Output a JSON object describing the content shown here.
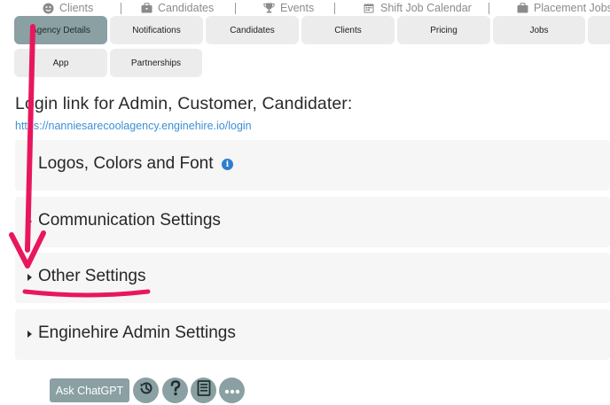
{
  "top_nav": {
    "items": [
      {
        "label": "Clients",
        "icon": "smiley-icon"
      },
      {
        "label": "Candidates",
        "icon": "briefcase-icon"
      },
      {
        "label": "Events",
        "icon": "trophy-icon"
      },
      {
        "label": "Shift Job Calendar",
        "icon": "calendar-icon"
      },
      {
        "label": "Placement Jobs",
        "icon": "briefcase-icon"
      }
    ]
  },
  "tabs": {
    "agency_details": "Agency Details",
    "notifications": "Notifications",
    "candidates": "Candidates",
    "clients": "Clients",
    "pricing": "Pricing",
    "jobs": "Jobs",
    "app": "App",
    "partnerships": "Partnerships",
    "active": "Agency Details"
  },
  "login": {
    "label": "Login link for Admin, Customer, Candidater:",
    "url": "https://nanniesarecoolagency.enginehire.io/login"
  },
  "sections": {
    "logos": "Logos, Colors and Font",
    "communication": "Communication Settings",
    "other": "Other Settings",
    "admin": "Enginehire Admin Settings"
  },
  "toolbar": {
    "ask_label": "Ask ChatGPT"
  },
  "colors": {
    "accent": "#8aa0a3",
    "annotation": "#e8175d",
    "link": "#3d8fd6",
    "info": "#2f7fd0"
  }
}
